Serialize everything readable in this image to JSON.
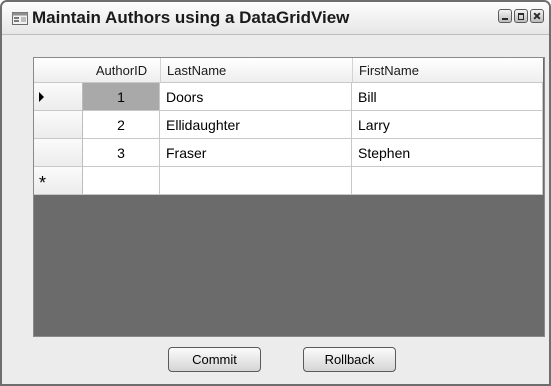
{
  "window": {
    "title": "Maintain Authors using a DataGridView",
    "controls": [
      "minimize-icon",
      "maximize-icon",
      "close-icon"
    ]
  },
  "grid": {
    "columns": [
      "AuthorID",
      "LastName",
      "FirstName"
    ],
    "rows": [
      {
        "AuthorID": "1",
        "LastName": "Doors",
        "FirstName": "Bill",
        "current": true
      },
      {
        "AuthorID": "2",
        "LastName": "Ellidaughter",
        "FirstName": "Larry",
        "current": false
      },
      {
        "AuthorID": "3",
        "LastName": "Fraser",
        "FirstName": "Stephen",
        "current": false
      }
    ],
    "new_row_marker": "*"
  },
  "buttons": {
    "commit": "Commit",
    "rollback": "Rollback"
  }
}
